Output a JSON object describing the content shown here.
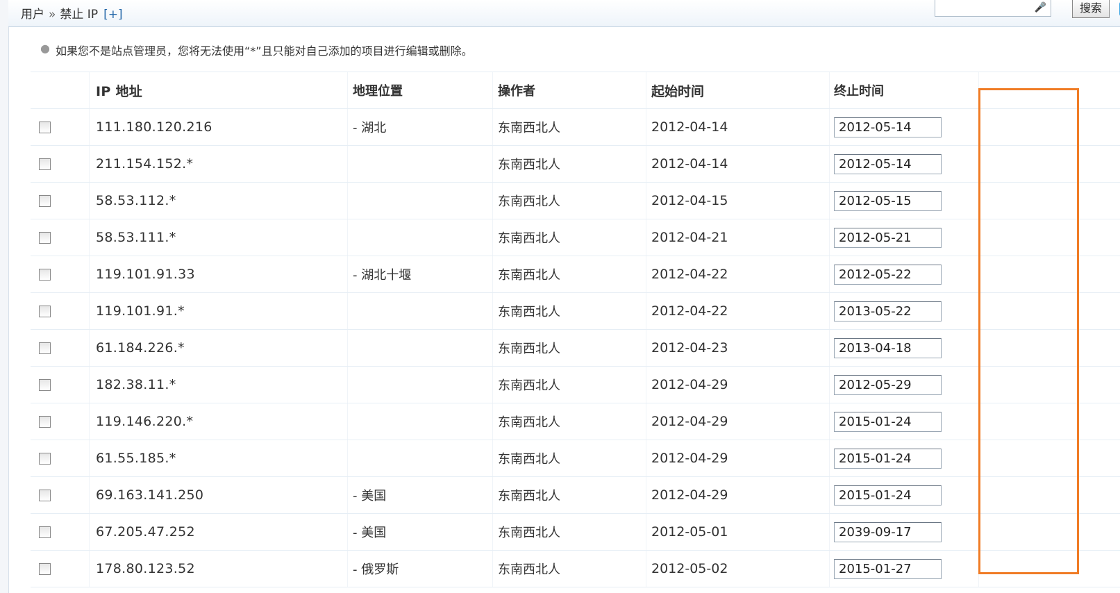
{
  "breadcrumb": {
    "part1": "用户",
    "separator": "»",
    "part2": "禁止 IP",
    "add_link": "[+]"
  },
  "search": {
    "button_label": "搜索",
    "value": ""
  },
  "notice": "如果您不是站点管理员，您将无法使用“*”且只能对自己添加的项目进行编辑或删除。",
  "table": {
    "headers": {
      "ip": "IP 地址",
      "geo": "地理位置",
      "operator": "操作者",
      "start": "起始时间",
      "end": "终止时间"
    },
    "rows": [
      {
        "ip": "111.180.120.216",
        "geo": "- 湖北",
        "operator": "东南西北人",
        "start": "2012-04-14",
        "end": "2012-05-14"
      },
      {
        "ip": "211.154.152.*",
        "geo": "",
        "operator": "东南西北人",
        "start": "2012-04-14",
        "end": "2012-05-14"
      },
      {
        "ip": "58.53.112.*",
        "geo": "",
        "operator": "东南西北人",
        "start": "2012-04-15",
        "end": "2012-05-15"
      },
      {
        "ip": "58.53.111.*",
        "geo": "",
        "operator": "东南西北人",
        "start": "2012-04-21",
        "end": "2012-05-21"
      },
      {
        "ip": "119.101.91.33",
        "geo": "- 湖北十堰",
        "operator": "东南西北人",
        "start": "2012-04-22",
        "end": "2012-05-22"
      },
      {
        "ip": "119.101.91.*",
        "geo": "",
        "operator": "东南西北人",
        "start": "2012-04-22",
        "end": "2013-05-22"
      },
      {
        "ip": "61.184.226.*",
        "geo": "",
        "operator": "东南西北人",
        "start": "2012-04-23",
        "end": "2013-04-18"
      },
      {
        "ip": "182.38.11.*",
        "geo": "",
        "operator": "东南西北人",
        "start": "2012-04-29",
        "end": "2012-05-29"
      },
      {
        "ip": "119.146.220.*",
        "geo": "",
        "operator": "东南西北人",
        "start": "2012-04-29",
        "end": "2015-01-24"
      },
      {
        "ip": "61.55.185.*",
        "geo": "",
        "operator": "东南西北人",
        "start": "2012-04-29",
        "end": "2015-01-24"
      },
      {
        "ip": "69.163.141.250",
        "geo": "- 美国",
        "operator": "东南西北人",
        "start": "2012-04-29",
        "end": "2015-01-24"
      },
      {
        "ip": "67.205.47.252",
        "geo": "- 美国",
        "operator": "东南西北人",
        "start": "2012-05-01",
        "end": "2039-09-17"
      },
      {
        "ip": "178.80.123.52",
        "geo": "- 俄罗斯",
        "operator": "东南西北人",
        "start": "2012-05-02",
        "end": "2015-01-27"
      }
    ]
  },
  "colors": {
    "highlight": "#f07c26",
    "link": "#2366a8",
    "row_border": "#e6eef5"
  },
  "icons": {
    "mic": "microphone-icon",
    "bullet": "bullet-icon"
  }
}
